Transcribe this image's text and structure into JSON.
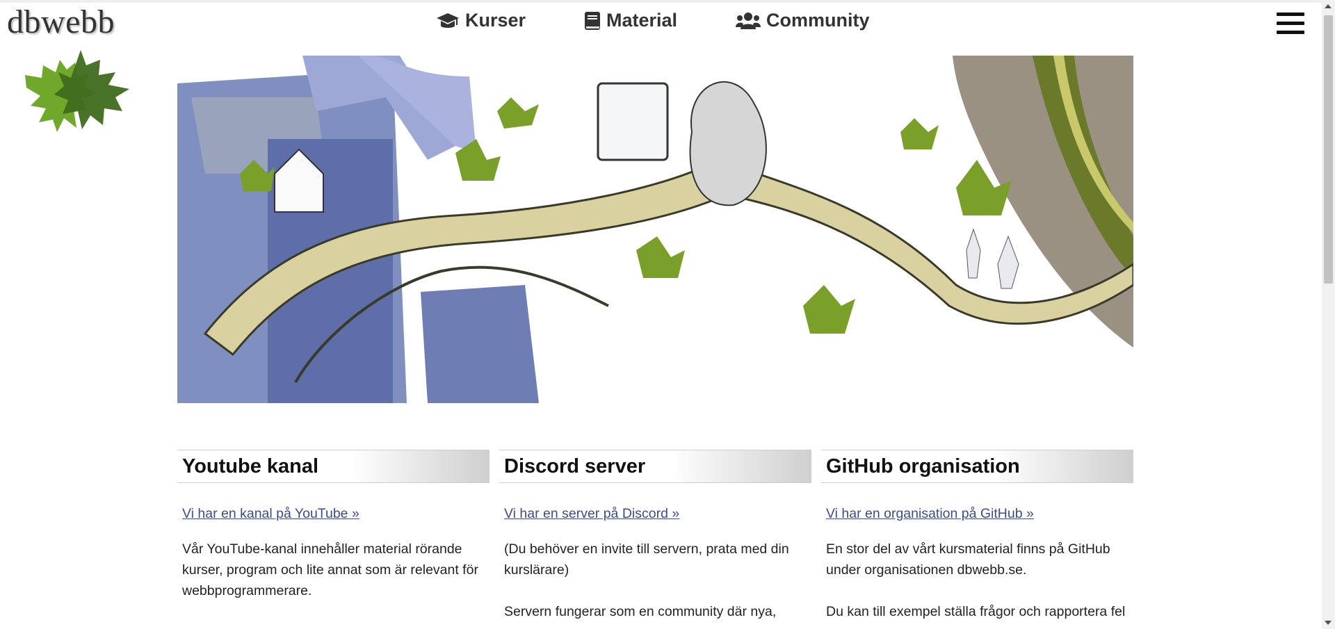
{
  "brand": {
    "logo_text": "dbwebb"
  },
  "nav": {
    "items": [
      {
        "label": "Kurser",
        "icon": "graduation-cap-icon"
      },
      {
        "label": "Material",
        "icon": "book-icon"
      },
      {
        "label": "Community",
        "icon": "users-icon"
      }
    ],
    "menu_icon": "hamburger-menu-icon"
  },
  "hero": {
    "description": ""
  },
  "columns": [
    {
      "title": "Youtube kanal",
      "link": "Vi har en kanal på YouTube »",
      "paragraphs": [
        "Vår YouTube-kanal innehåller material rörande kurser, program och lite annat som är relevant för webbprogrammerare."
      ]
    },
    {
      "title": "Discord server",
      "link": "Vi har en server på Discord »",
      "paragraphs": [
        "(Du behöver en invite till servern, prata med din kurslärare)",
        "Servern fungerar som en community där nya,"
      ]
    },
    {
      "title": "GitHub organisation",
      "link": "Vi har en organisation på GitHub »",
      "paragraphs": [
        "En stor del av vårt kursmaterial finns på GitHub under organisationen dbwebb.se.",
        "Du kan till exempel ställa frågor och rapportera fel"
      ]
    }
  ],
  "colors": {
    "link": "#3b4c8c",
    "heading_gradient_end": "#cfcfcf",
    "leaf_dark": "#3f6b1e",
    "leaf_light": "#6fa82a"
  }
}
